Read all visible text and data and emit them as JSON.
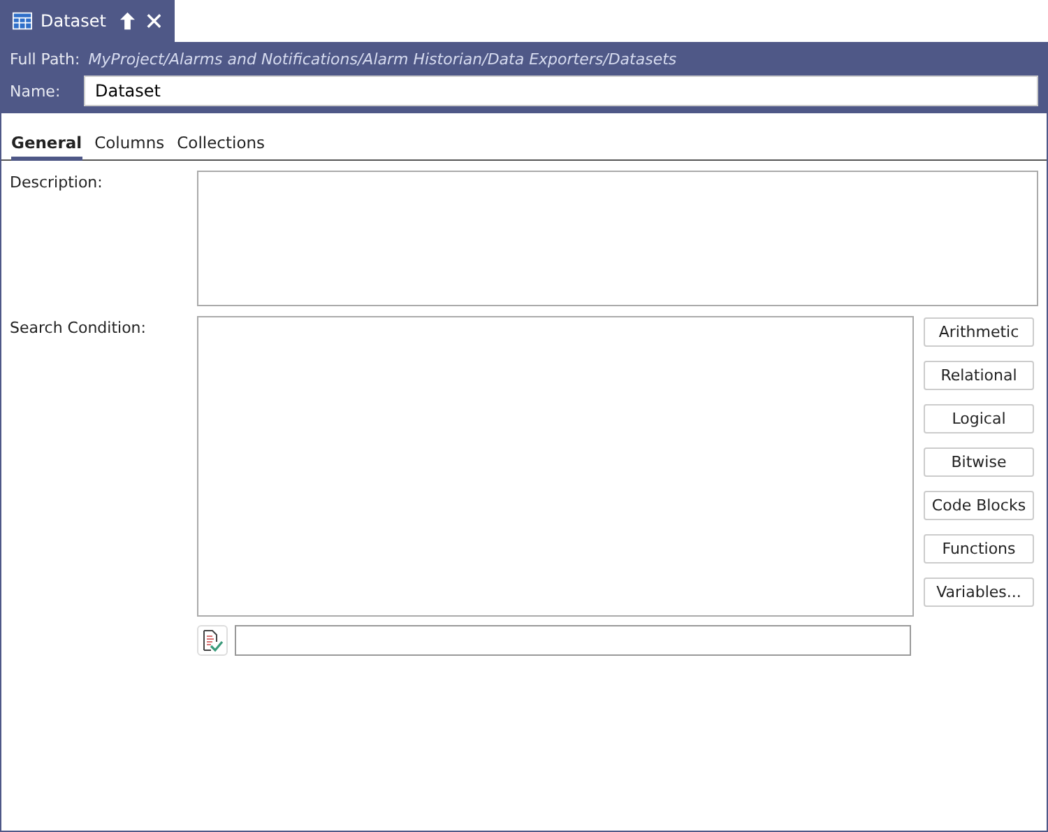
{
  "document_tab": {
    "title": "Dataset"
  },
  "header": {
    "path_label": "Full Path:",
    "path": "MyProject/Alarms and Notifications/Alarm Historian/Data Exporters/Datasets",
    "name_label": "Name:",
    "name_value": "Dataset"
  },
  "tabs": [
    {
      "label": "General",
      "selected": true
    },
    {
      "label": "Columns",
      "selected": false
    },
    {
      "label": "Collections",
      "selected": false
    }
  ],
  "description": {
    "label": "Description:"
  },
  "search_condition": {
    "label": "Search Condition:"
  },
  "buttons": [
    "Arithmetic",
    "Relational",
    "Logical",
    "Bitwise",
    "Code Blocks",
    "Functions",
    "Variables..."
  ]
}
